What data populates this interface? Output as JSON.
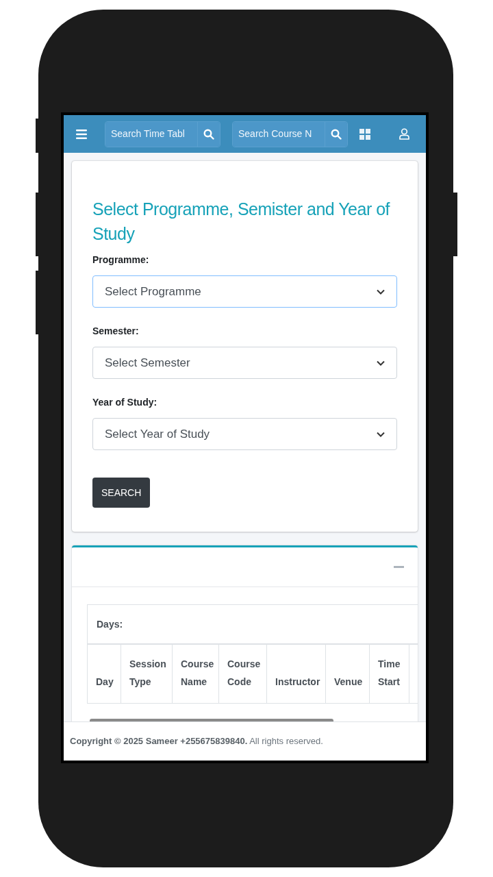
{
  "navbar": {
    "search_timetable": {
      "placeholder": "Search Time Tabl"
    },
    "search_course": {
      "placeholder": "Search Course N"
    }
  },
  "form_card": {
    "title": "Select Programme, Semister and Year of Study",
    "fields": [
      {
        "label": "Programme:",
        "value": "Select Programme"
      },
      {
        "label": "Semester:",
        "value": "Select Semester"
      },
      {
        "label": "Year of Study:",
        "value": "Select Year of Study"
      }
    ],
    "button": "SEARCH"
  },
  "timetable_card": {
    "days_label": "Days:",
    "columns": [
      [
        "Day"
      ],
      [
        "Session",
        "Type"
      ],
      [
        "Course",
        "Name"
      ],
      [
        "Course",
        "Code"
      ],
      [
        "Instructor"
      ],
      [
        "Venue"
      ],
      [
        "Time",
        "Start"
      ]
    ]
  },
  "footer": "**Copyright © 2025 Sameer +255675839840.** All rights reserved."
}
